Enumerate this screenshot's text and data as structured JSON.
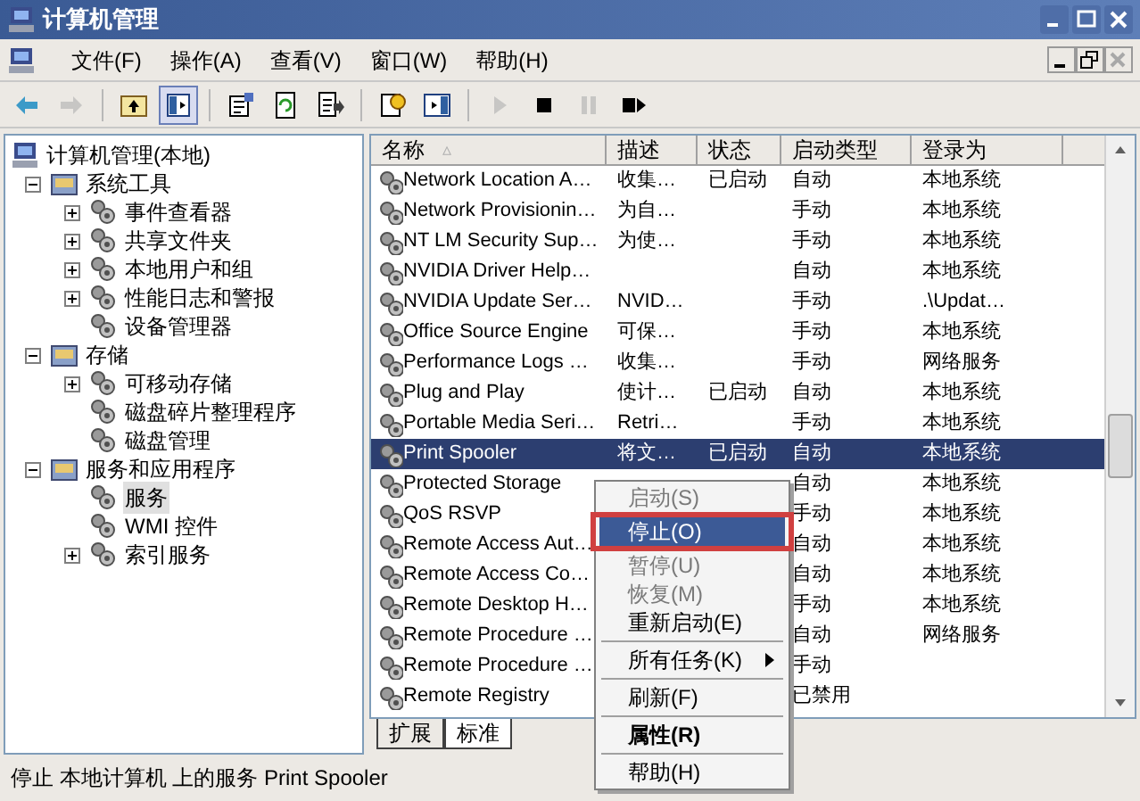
{
  "window": {
    "title": "计算机管理"
  },
  "menu_bar": [
    {
      "label": "文件(F)"
    },
    {
      "label": "操作(A)"
    },
    {
      "label": "查看(V)"
    },
    {
      "label": "窗口(W)"
    },
    {
      "label": "帮助(H)"
    }
  ],
  "toolbar": [
    {
      "kind": "back",
      "disabled": false
    },
    {
      "kind": "forward",
      "disabled": true
    },
    {
      "kind": "sep"
    },
    {
      "kind": "up",
      "disabled": false
    },
    {
      "kind": "tree",
      "disabled": false,
      "pressed": true
    },
    {
      "kind": "sep"
    },
    {
      "kind": "props",
      "disabled": false
    },
    {
      "kind": "refresh",
      "disabled": false
    },
    {
      "kind": "export",
      "disabled": false
    },
    {
      "kind": "sep"
    },
    {
      "kind": "help",
      "disabled": false
    },
    {
      "kind": "pane",
      "disabled": false
    },
    {
      "kind": "sep"
    },
    {
      "kind": "play",
      "disabled": true
    },
    {
      "kind": "stop",
      "disabled": false
    },
    {
      "kind": "pause",
      "disabled": true
    },
    {
      "kind": "restart",
      "disabled": false
    }
  ],
  "tree": [
    {
      "label": "计算机管理(本地)",
      "selected": false,
      "children": [
        {
          "label": "系统工具",
          "expanded": true,
          "selected": false,
          "children": [
            {
              "label": "事件查看器",
              "expanded": false,
              "selected": false
            },
            {
              "label": "共享文件夹",
              "expanded": false,
              "selected": false
            },
            {
              "label": "本地用户和组",
              "expanded": false,
              "selected": false
            },
            {
              "label": "性能日志和警报",
              "expanded": false,
              "selected": false
            },
            {
              "label": "设备管理器",
              "selected": false
            }
          ]
        },
        {
          "label": "存储",
          "expanded": true,
          "selected": false,
          "children": [
            {
              "label": "可移动存储",
              "expanded": false,
              "selected": false
            },
            {
              "label": "磁盘碎片整理程序",
              "selected": false
            },
            {
              "label": "磁盘管理",
              "selected": false
            }
          ]
        },
        {
          "label": "服务和应用程序",
          "expanded": true,
          "selected": false,
          "children": [
            {
              "label": "服务",
              "selected": true
            },
            {
              "label": "WMI 控件",
              "selected": false
            },
            {
              "label": "索引服务",
              "expanded": false,
              "selected": false
            }
          ]
        }
      ]
    }
  ],
  "table": {
    "columns": [
      "名称",
      "描述",
      "状态",
      "启动类型",
      "登录为"
    ],
    "sort_mark": "▵",
    "rows": [
      {
        "cells": [
          "Network Location A…",
          "收集…",
          "已启动",
          "自动",
          "本地系统"
        ],
        "selected": false
      },
      {
        "cells": [
          "Network Provisionin…",
          "为自…",
          "",
          "手动",
          "本地系统"
        ],
        "selected": false
      },
      {
        "cells": [
          "NT LM Security Sup…",
          "为使…",
          "",
          "手动",
          "本地系统"
        ],
        "selected": false
      },
      {
        "cells": [
          "NVIDIA Driver Help…",
          "",
          "",
          "自动",
          "本地系统"
        ],
        "selected": false
      },
      {
        "cells": [
          "NVIDIA Update Ser…",
          "NVID…",
          "",
          "手动",
          ".\\Updat…"
        ],
        "selected": false
      },
      {
        "cells": [
          "Office Source Engine",
          "可保…",
          "",
          "手动",
          "本地系统"
        ],
        "selected": false
      },
      {
        "cells": [
          "Performance Logs …",
          "收集…",
          "",
          "手动",
          "网络服务"
        ],
        "selected": false
      },
      {
        "cells": [
          "Plug and Play",
          "使计…",
          "已启动",
          "自动",
          "本地系统"
        ],
        "selected": false
      },
      {
        "cells": [
          "Portable Media Seri…",
          "Retri…",
          "",
          "手动",
          "本地系统"
        ],
        "selected": false
      },
      {
        "cells": [
          "Print Spooler",
          "将文…",
          "已启动",
          "自动",
          "本地系统"
        ],
        "selected": true
      },
      {
        "cells": [
          "Protected Storage",
          "",
          "",
          "自动",
          "本地系统"
        ],
        "selected": false
      },
      {
        "cells": [
          "QoS RSVP",
          "",
          "",
          "手动",
          "本地系统"
        ],
        "selected": false
      },
      {
        "cells": [
          "Remote Access Aut…",
          "",
          "",
          "自动",
          "本地系统"
        ],
        "selected": false
      },
      {
        "cells": [
          "Remote Access Co…",
          "",
          "",
          "自动",
          "本地系统"
        ],
        "selected": false
      },
      {
        "cells": [
          "Remote Desktop H…",
          "",
          "",
          "手动",
          "本地系统"
        ],
        "selected": false
      },
      {
        "cells": [
          "Remote Procedure …",
          "",
          "",
          "自动",
          "网络服务"
        ],
        "selected": false
      },
      {
        "cells": [
          "Remote Procedure …",
          "",
          "",
          "手动",
          ""
        ],
        "selected": false
      },
      {
        "cells": [
          "Remote Registry",
          "",
          "",
          "已禁用",
          ""
        ],
        "selected": false
      }
    ]
  },
  "bottom_tabs": [
    {
      "label": "扩展",
      "selected": false
    },
    {
      "label": "标准",
      "selected": true
    }
  ],
  "context_menu": [
    {
      "kind": "item",
      "label": "启动(S)",
      "disabled": true,
      "selected": false
    },
    {
      "kind": "item",
      "label": "停止(O)",
      "disabled": false,
      "selected": true,
      "annotated": true
    },
    {
      "kind": "item",
      "label": "暂停(U)",
      "disabled": true,
      "selected": false
    },
    {
      "kind": "item",
      "label": "恢复(M)",
      "disabled": true,
      "selected": false
    },
    {
      "kind": "item",
      "label": "重新启动(E)",
      "disabled": false,
      "selected": false
    },
    {
      "kind": "separator"
    },
    {
      "kind": "item",
      "label": "所有任务(K)",
      "disabled": false,
      "selected": false,
      "submenu": true
    },
    {
      "kind": "separator"
    },
    {
      "kind": "item",
      "label": "刷新(F)",
      "disabled": false,
      "selected": false
    },
    {
      "kind": "separator"
    },
    {
      "kind": "item",
      "label": "属性(R)",
      "disabled": false,
      "selected": false,
      "default": true
    },
    {
      "kind": "separator"
    },
    {
      "kind": "item",
      "label": "帮助(H)",
      "disabled": false,
      "selected": false
    }
  ],
  "status_bar": {
    "text": "停止 本地计算机 上的服务 Print Spooler"
  }
}
